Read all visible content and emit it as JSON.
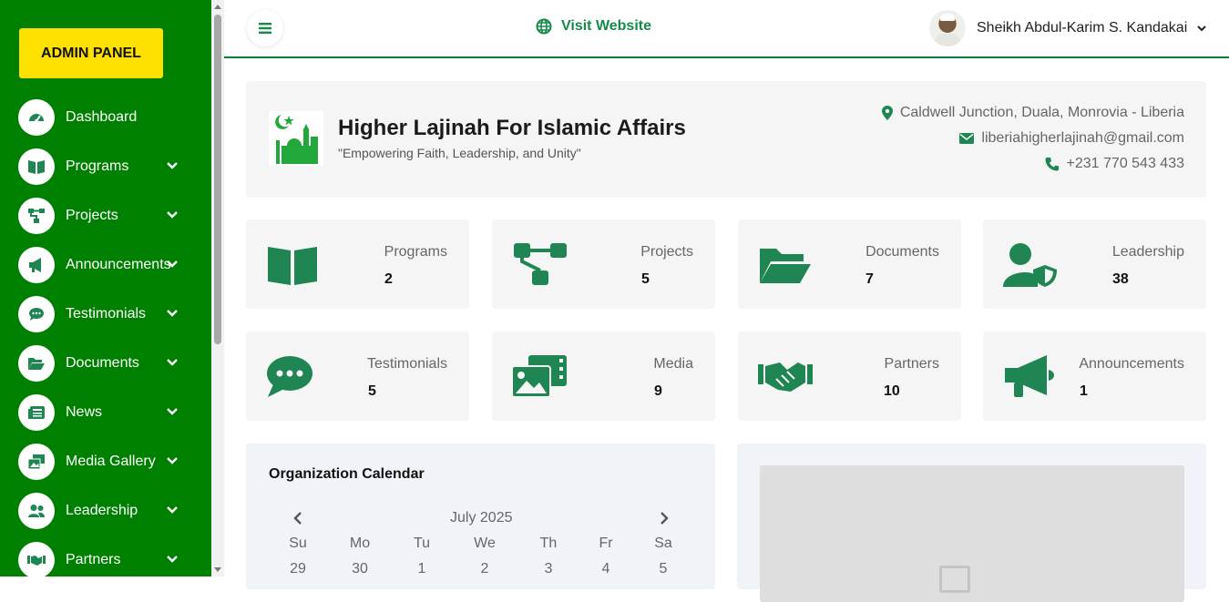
{
  "sidebar": {
    "admin_label": "ADMIN PANEL",
    "items": [
      {
        "label": "Dashboard",
        "icon": "gauge-icon",
        "has_submenu": false
      },
      {
        "label": "Programs",
        "icon": "book-open-icon",
        "has_submenu": true
      },
      {
        "label": "Projects",
        "icon": "sitemap-icon",
        "has_submenu": true
      },
      {
        "label": "Announcements",
        "icon": "megaphone-icon",
        "has_submenu": true
      },
      {
        "label": "Testimonials",
        "icon": "comment-dots-icon",
        "has_submenu": true
      },
      {
        "label": "Documents",
        "icon": "folder-open-icon",
        "has_submenu": true
      },
      {
        "label": "News",
        "icon": "newspaper-icon",
        "has_submenu": true
      },
      {
        "label": "Media Gallery",
        "icon": "photo-film-icon",
        "has_submenu": true
      },
      {
        "label": "Leadership",
        "icon": "users-icon",
        "has_submenu": true
      },
      {
        "label": "Partners",
        "icon": "handshake-icon",
        "has_submenu": true
      }
    ]
  },
  "topbar": {
    "visit_label": "Visit Website",
    "user_name": "Sheikh Abdul-Karim S. Kandakai"
  },
  "org": {
    "name": "Higher Lajinah For Islamic Affairs",
    "tagline": "\"Empowering Faith, Leadership, and Unity\"",
    "address": "Caldwell Junction, Duala, Monrovia - Liberia",
    "email": "liberiahigherlajinah@gmail.com",
    "phone": "+231 770 543 433"
  },
  "stats": [
    {
      "label": "Programs",
      "value": "2",
      "icon": "book-open-icon"
    },
    {
      "label": "Projects",
      "value": "5",
      "icon": "sitemap-icon"
    },
    {
      "label": "Documents",
      "value": "7",
      "icon": "folder-open-icon"
    },
    {
      "label": "Leadership",
      "value": "38",
      "icon": "user-shield-icon"
    },
    {
      "label": "Testimonials",
      "value": "5",
      "icon": "comment-dots-icon"
    },
    {
      "label": "Media",
      "value": "9",
      "icon": "photo-film-icon"
    },
    {
      "label": "Partners",
      "value": "10",
      "icon": "handshake-icon"
    },
    {
      "label": "Announcements",
      "value": "1",
      "icon": "megaphone-icon"
    }
  ],
  "calendar": {
    "title": "Organization Calendar",
    "month": "July 2025",
    "weekdays": [
      "Su",
      "Mo",
      "Tu",
      "We",
      "Th",
      "Fr",
      "Sa"
    ],
    "first_row": [
      "29",
      "30",
      "1",
      "2",
      "3",
      "4",
      "5"
    ]
  },
  "colors": {
    "sidebar": "#008000",
    "accent_yellow": "#ffe100",
    "icon_green": "#1e8553",
    "brand_text_green": "#178a4a"
  }
}
